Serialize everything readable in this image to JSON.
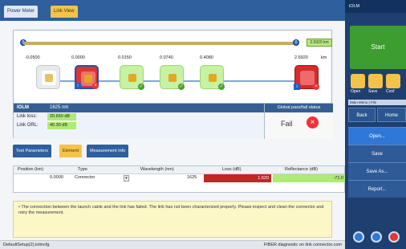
{
  "tabs": {
    "power_meter": "Power Meter",
    "link_view": "Link View"
  },
  "link": {
    "length_badge": "2.5920 km",
    "distances": [
      "-0.0500",
      "0.0000",
      "0.0150",
      "0.0740",
      "0.4080",
      "2.6920"
    ],
    "distance_unit": "km"
  },
  "info": {
    "iolm_label": "IOLM",
    "wavelength": "1625 nm",
    "link_loss_label": "Link loss:",
    "link_loss": "20.650 dB",
    "link_orl_label": "Link ORL:",
    "link_orl": "40.30 dB"
  },
  "passfail": {
    "title": "Global pass/fail status",
    "value": "Fail"
  },
  "bottom_tabs": {
    "params": "Test Parameters",
    "element": "Element",
    "measure": "Measurement Info"
  },
  "table": {
    "headers": {
      "position": "Position (km)",
      "type": "Type",
      "wavelength": "Wavelength (nm)",
      "loss": "Loss (dB)",
      "reflectance": "Reflectance (dB)"
    },
    "row": {
      "position": "0.0000",
      "type": "Connector",
      "wavelength": "1625",
      "loss": "1.620",
      "reflectance": "-71.0"
    }
  },
  "message": "• The connection between the launch cable and the link has failed. The link has not been characterized properly. Please inspect and clean the connector and retry the measurement.",
  "status": {
    "left": "DefaultSetup(2).iolmcfg",
    "right": "FIBER diagnostic on link connector.com"
  },
  "side": {
    "top": "iOLM",
    "start": "Start",
    "icons": [
      "Open",
      "Save",
      "Conf"
    ],
    "main_menu": "Main Menu | File",
    "back": "Back",
    "home": "Home",
    "buttons": [
      "Open...",
      "Save",
      "Save As...",
      "Report..."
    ]
  },
  "colors": {
    "accent": "#2f5f9d",
    "fail": "#e33333",
    "pass": "#aeea78"
  }
}
